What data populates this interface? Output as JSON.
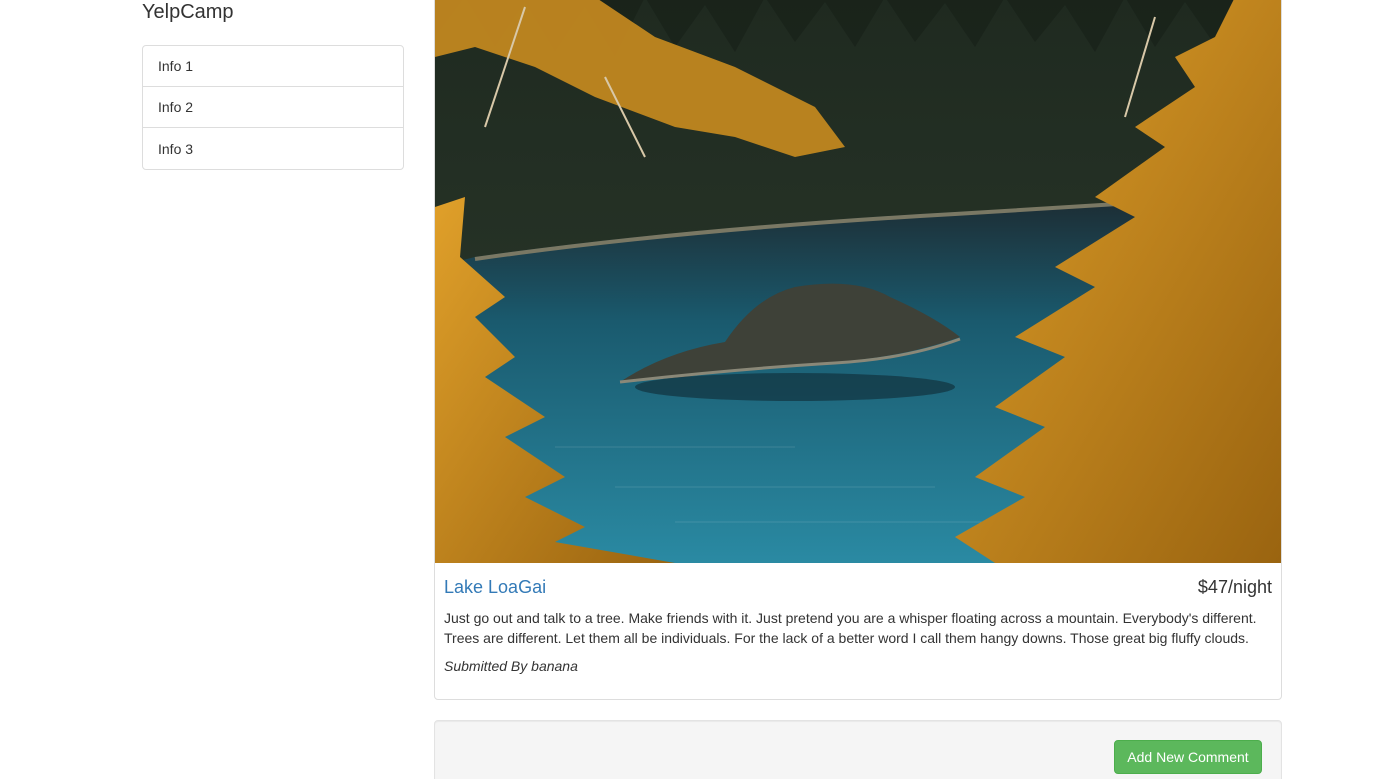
{
  "app": {
    "brand": "YelpCamp"
  },
  "sidebar": {
    "items": [
      {
        "label": "Info 1"
      },
      {
        "label": "Info 2"
      },
      {
        "label": "Info 3"
      }
    ]
  },
  "campground": {
    "name": "Lake LoaGai",
    "price": "$47/night",
    "description": "Just go out and talk to a tree. Make friends with it. Just pretend you are a whisper floating across a mountain. Everybody's different. Trees are different. Let them all be individuals. For the lack of a better word I call them hangy downs. Those great big fluffy clouds.",
    "submitted_label": "Submitted By",
    "author": "banana"
  },
  "comments": {
    "add_button_label": "Add New Comment"
  },
  "colors": {
    "link": "#337ab7",
    "success": "#5cb85c",
    "border": "#dddddd",
    "well": "#f5f5f5"
  },
  "icons": {
    "hero_image": "lake-forest-photo"
  }
}
